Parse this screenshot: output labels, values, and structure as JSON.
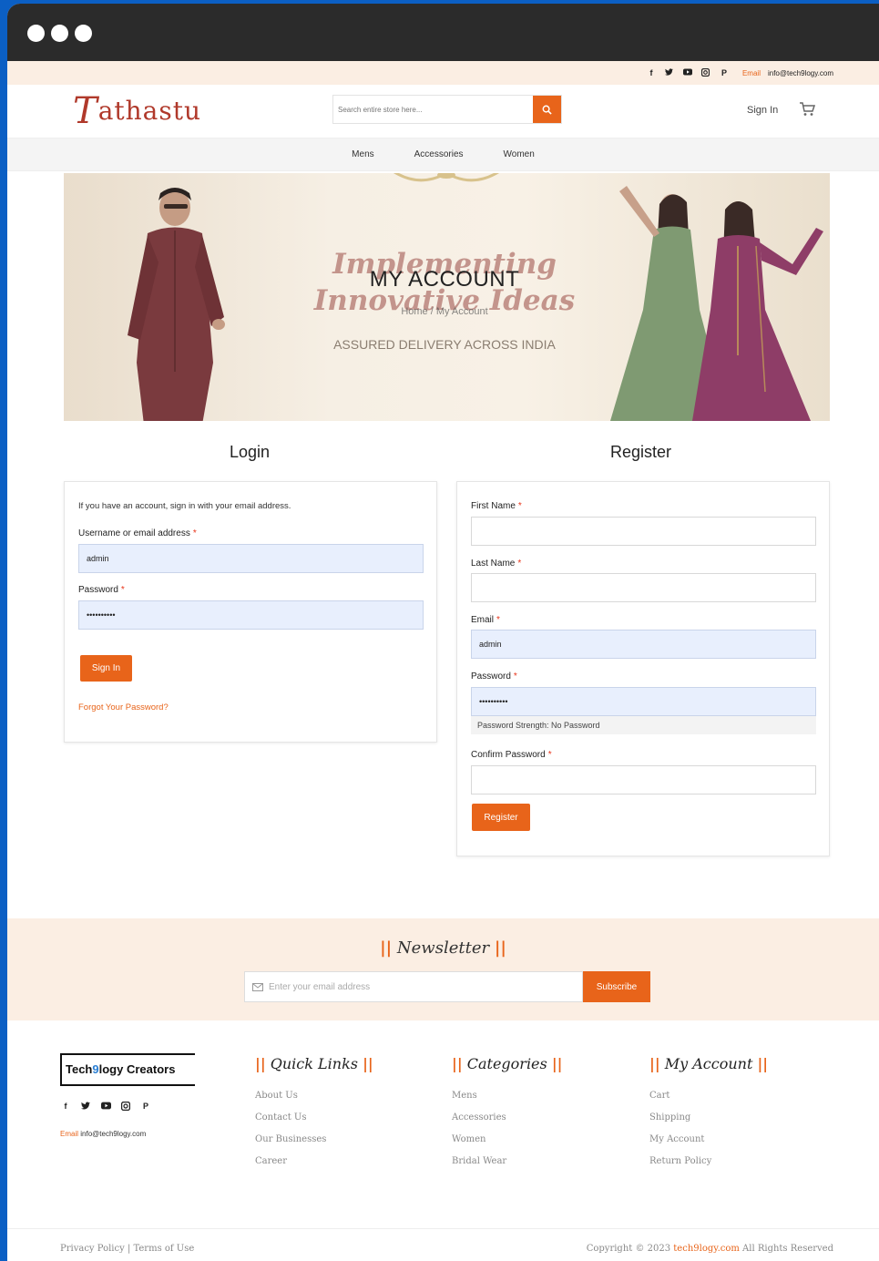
{
  "topbar": {
    "socials": [
      "facebook-icon",
      "twitter-icon",
      "youtube-icon",
      "instagram-icon",
      "pinterest-icon"
    ],
    "email_label": "Email",
    "email_value": "info@tech9logy.com"
  },
  "header": {
    "logo_initial": "T",
    "logo_rest": "athastu",
    "search_placeholder": "Search entire store here...",
    "signin_label": "Sign In"
  },
  "nav": {
    "items": [
      "Mens",
      "Accessories",
      "Women"
    ]
  },
  "banner": {
    "script_line1": "Implementing",
    "script_line2": "Innovative Ideas",
    "title": "MY ACCOUNT",
    "breadcrumb": "Home / My Account",
    "tagline": "ASSURED DELIVERY ACROSS INDIA"
  },
  "login": {
    "title": "Login",
    "intro": "If you have an account, sign in with your email address.",
    "username_label": "Username or email address",
    "username_value": "admin",
    "password_label": "Password",
    "password_value": "••••••••••",
    "signin_button": "Sign In",
    "forgot_link": "Forgot Your Password?"
  },
  "register": {
    "title": "Register",
    "first_name_label": "First Name",
    "last_name_label": "Last Name",
    "email_label": "Email",
    "email_value": "admin",
    "password_label": "Password",
    "password_value": "••••••••••",
    "strength_text": "Password Strength: No Password",
    "confirm_label": "Confirm Password",
    "register_button": "Register"
  },
  "newsletter": {
    "bars": "||",
    "title": "Newsletter",
    "placeholder": "Enter your email address",
    "subscribe_button": "Subscribe"
  },
  "footer": {
    "logo_part1": "Tech",
    "logo_nine": "9",
    "logo_part2": "logy Creators",
    "email_label": "Email",
    "email_value": "info@tech9logy.com",
    "columns": [
      {
        "title": "Quick Links",
        "items": [
          "About Us",
          "Contact Us",
          "Our Businesses",
          "Career"
        ]
      },
      {
        "title": "Categories",
        "items": [
          "Mens",
          "Accessories",
          "Women",
          "Bridal Wear"
        ]
      },
      {
        "title": "My Account",
        "items": [
          "Cart",
          "Shipping",
          "My Account",
          "Return Policy"
        ]
      }
    ],
    "privacy": "Privacy Policy",
    "separator": "|",
    "terms": "Terms of Use",
    "copyright_pre": "Copyright © 2023",
    "copyright_brand": "tech9logy.com",
    "copyright_post": "All Rights Reserved"
  },
  "colors": {
    "accent": "#e8641a",
    "topbar_bg": "#fbeee3",
    "frame": "#0b5fc4",
    "titlebar": "#2b2b2b"
  }
}
